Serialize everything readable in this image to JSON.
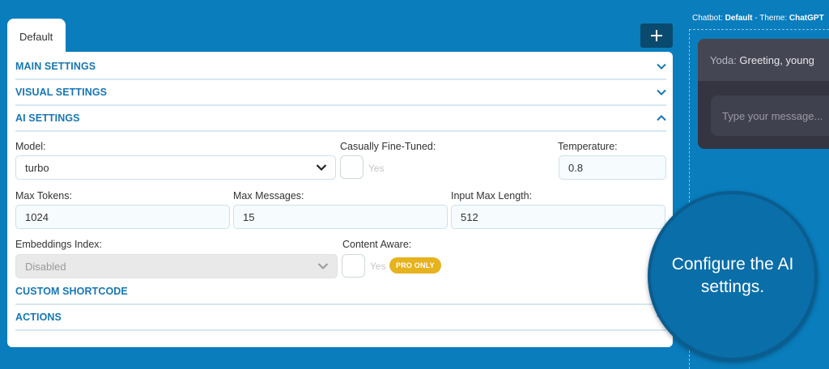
{
  "tabs": [
    {
      "label": "Default"
    }
  ],
  "add_button": {
    "icon": "plus-icon"
  },
  "sections": {
    "main": {
      "title": "MAIN SETTINGS",
      "icon": "chevron-down-icon"
    },
    "visual": {
      "title": "VISUAL SETTINGS",
      "icon": "chevron-down-icon"
    },
    "ai": {
      "title": "AI SETTINGS",
      "icon": "chevron-up-icon"
    },
    "shortcode": {
      "title": "CUSTOM SHORTCODE"
    },
    "actions": {
      "title": "ACTIONS",
      "icon": "chevron-down-icon"
    }
  },
  "ai_settings": {
    "model": {
      "label": "Model:",
      "value": "turbo"
    },
    "fine_tuned": {
      "label": "Casually Fine-Tuned:",
      "yes": "Yes"
    },
    "temperature": {
      "label": "Temperature:",
      "value": "0.8"
    },
    "max_tokens": {
      "label": "Max Tokens:",
      "value": "1024"
    },
    "max_messages": {
      "label": "Max Messages:",
      "value": "15"
    },
    "input_max_length": {
      "label": "Input Max Length:",
      "value": "512"
    },
    "embeddings_index": {
      "label": "Embeddings Index:",
      "value": "Disabled"
    },
    "content_aware": {
      "label": "Content Aware:",
      "yes": "Yes",
      "badge": "PRO ONLY"
    }
  },
  "preview": {
    "chatbot_label": "Chatbot:",
    "chatbot_value": "Default",
    "separator": " - ",
    "theme_label": "Theme:",
    "theme_value": "ChatGPT",
    "message_who": "Yoda:",
    "message_text": "Greeting, young",
    "input_placeholder": "Type your message..."
  },
  "callout": {
    "text": "Configure the AI settings."
  },
  "colors": {
    "background": "#0a7dbd",
    "accent": "#1876b0",
    "badge": "#e6b21e",
    "button": "#0b4a6f"
  }
}
